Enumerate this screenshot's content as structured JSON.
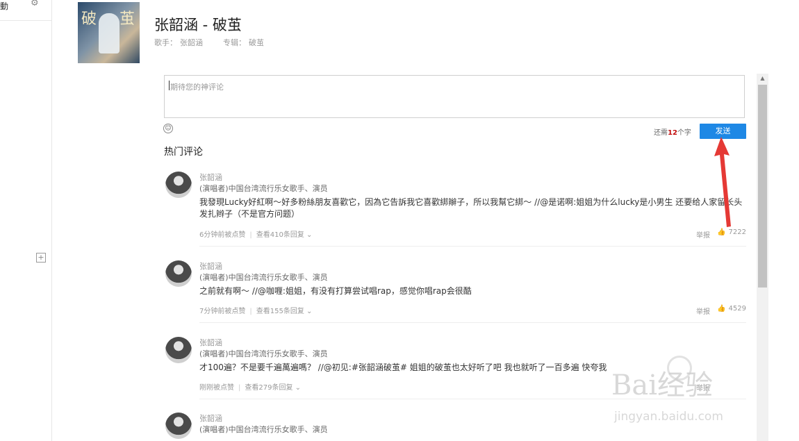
{
  "sidebar": {
    "top_label": "動",
    "gear_icon": "gear-icon",
    "add_icon": "plus-box-icon"
  },
  "song": {
    "title": "张韶涵 - 破茧",
    "singer_label": "歌手：",
    "singer": "张韶涵",
    "album_label": "专辑：",
    "album": "破茧"
  },
  "comment_box": {
    "placeholder": "期待您的神评论",
    "remain_prefix": "还需",
    "remain_count": "12",
    "remain_suffix": "个字",
    "send_label": "发送",
    "emoji_icon": "smiley-icon"
  },
  "hot_title": "热门评论",
  "comments": [
    {
      "name": "张韶涵",
      "role": "(演唱者)中国台湾流行乐女歌手、演员",
      "text": "我發現Lucky好紅啊～好多粉絲朋友喜歡它，因為它告訴我它喜歡綁辮子，所以我幫它綁～ //@是诺啊:姐姐为什么lucky是小男生 还要给人家留长头发扎辫子（不是官方问题）",
      "time": "6分钟前被点赞",
      "replies": "查看410条回复",
      "report": "举报",
      "likes": "7222"
    },
    {
      "name": "张韶涵",
      "role": "(演唱者)中国台湾流行乐女歌手、演员",
      "text": "之前就有啊～ //@咖喱:姐姐，有没有打算尝试唱rap，感觉你唱rap会很酷",
      "time": "7分钟前被点赞",
      "replies": "查看155条回复",
      "report": "举报",
      "likes": "4529"
    },
    {
      "name": "张韶涵",
      "role": "(演唱者)中国台湾流行乐女歌手、演员",
      "text": "才100遍？不是要千遍萬遍嗎？ //@初见:#张韶涵破茧# 姐姐的破茧也太好听了吧 我也就听了一百多遍 快夸我",
      "time": "刚刚被点赞",
      "replies": "查看279条回复",
      "report": "举报",
      "likes": ""
    },
    {
      "name": "张韶涵",
      "role": "(演唱者)中国台湾流行乐女歌手、演员",
      "text": ""
    }
  ],
  "watermark": {
    "main": "Bai经验",
    "sub": "jingyan.baidu.com"
  },
  "colors": {
    "send_button": "#1e88e5",
    "arrow": "#e53935",
    "remain_num": "#c20c0c"
  }
}
